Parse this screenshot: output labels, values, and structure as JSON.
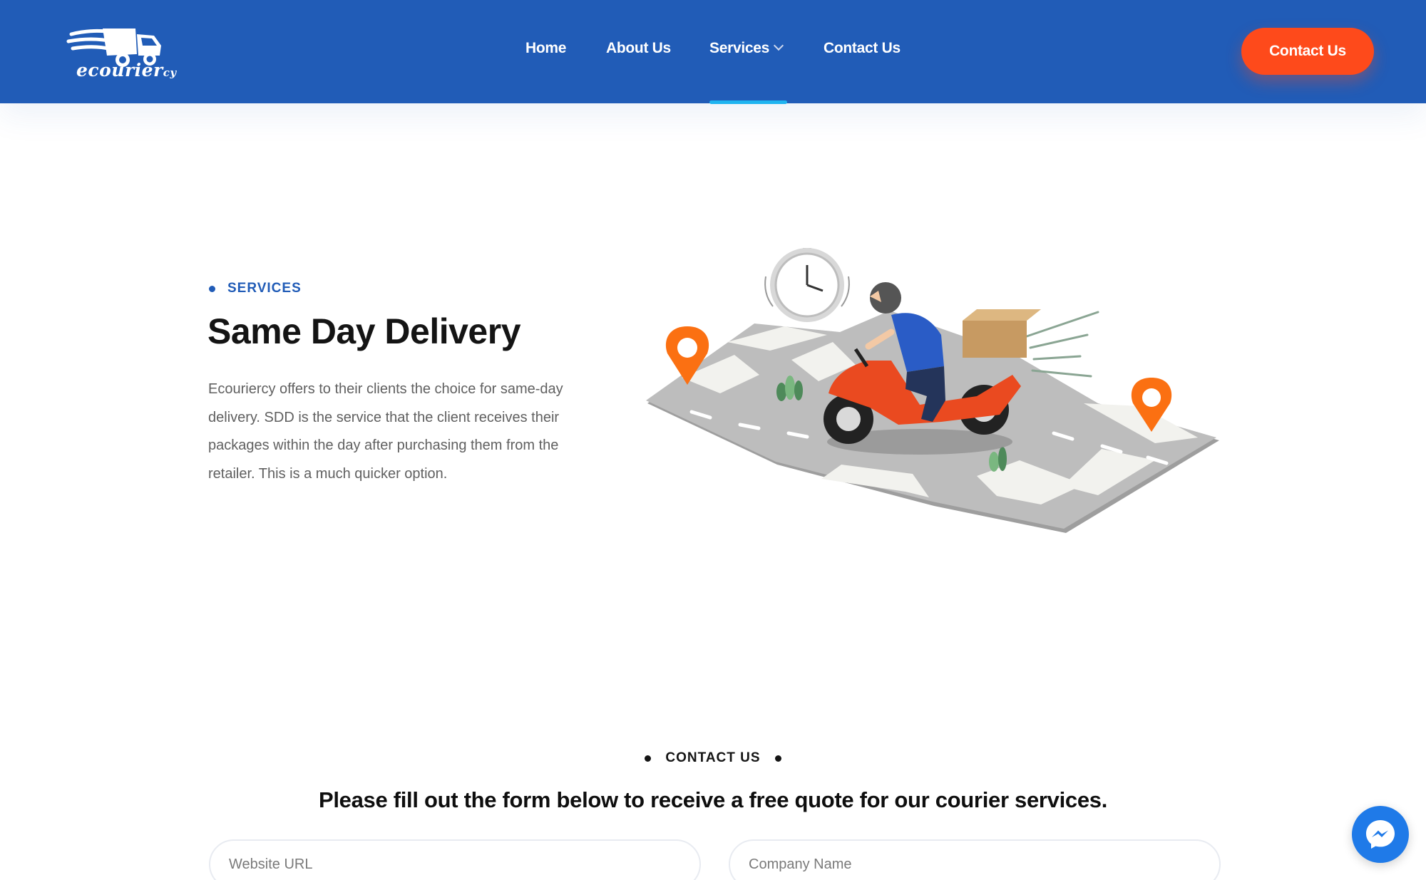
{
  "header": {
    "logo_text": "ecourier",
    "logo_suffix": "cy",
    "nav": [
      {
        "label": "Home"
      },
      {
        "label": "About Us"
      },
      {
        "label": "Services",
        "has_dropdown": true,
        "active": true
      },
      {
        "label": "Contact Us"
      }
    ],
    "cta_label": "Contact Us"
  },
  "hero": {
    "eyebrow": "SERVICES",
    "title": "Same Day Delivery",
    "description": "Ecouriercy offers to their clients the choice for same-day delivery. SDD is the service that the client receives their packages within the day after purchasing them from the retailer. This is a much quicker option.",
    "illustration": "scooter-courier-delivery-map"
  },
  "contact": {
    "eyebrow": "CONTACT US",
    "title": "Please fill out the form below to receive a free quote for our courier services.",
    "fields": [
      {
        "placeholder": "Website URL",
        "value": ""
      },
      {
        "placeholder": "Company Name",
        "value": ""
      }
    ]
  },
  "chat_widget": {
    "icon": "messenger-icon"
  },
  "colors": {
    "header_bg": "#215cb7",
    "accent": "#fe4a1b",
    "active_underline": "#1fb4f0",
    "pin": "#fb7012"
  }
}
